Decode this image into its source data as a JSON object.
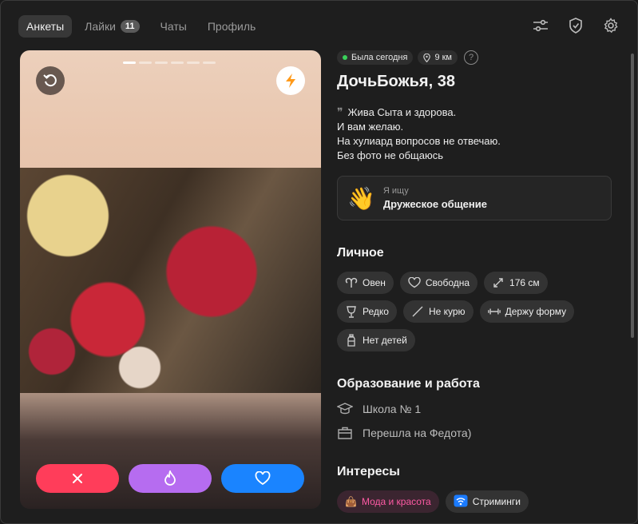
{
  "nav": {
    "tabs": [
      {
        "label": "Анкеты",
        "active": true
      },
      {
        "label": "Лайки",
        "badge": "11"
      },
      {
        "label": "Чаты"
      },
      {
        "label": "Профиль"
      }
    ],
    "icons": [
      "filters-icon",
      "shield-icon",
      "gear-icon"
    ]
  },
  "profile": {
    "status": "Была сегодня",
    "distance": "9 км",
    "help": "?",
    "name": "ДочьБожья, 38",
    "bio": [
      "Жива Сыта и здорова.",
      "И вам желаю.",
      "На хулиард вопросов не отвечаю.",
      "Без фото не общаюсь"
    ],
    "looking_label": "Я ищу",
    "looking_value": "Дружеское общение"
  },
  "personal": {
    "title": "Личное",
    "chips": [
      "Овен",
      "Свободна",
      "176 см",
      "Редко",
      "Не курю",
      "Держу форму",
      "Нет детей"
    ]
  },
  "education": {
    "title": "Образование и работа",
    "school": "Школа № 1",
    "work": "Перешла на Федота)"
  },
  "interests": {
    "title": "Интересы",
    "items": [
      "Мода и красота",
      "Стриминги"
    ]
  },
  "colors": {
    "dislike": "#ff3d5a",
    "superlike": "#b66cf0",
    "like": "#1a84ff",
    "online": "#3ad15a"
  },
  "photo": {
    "count": 6,
    "current": 1
  }
}
